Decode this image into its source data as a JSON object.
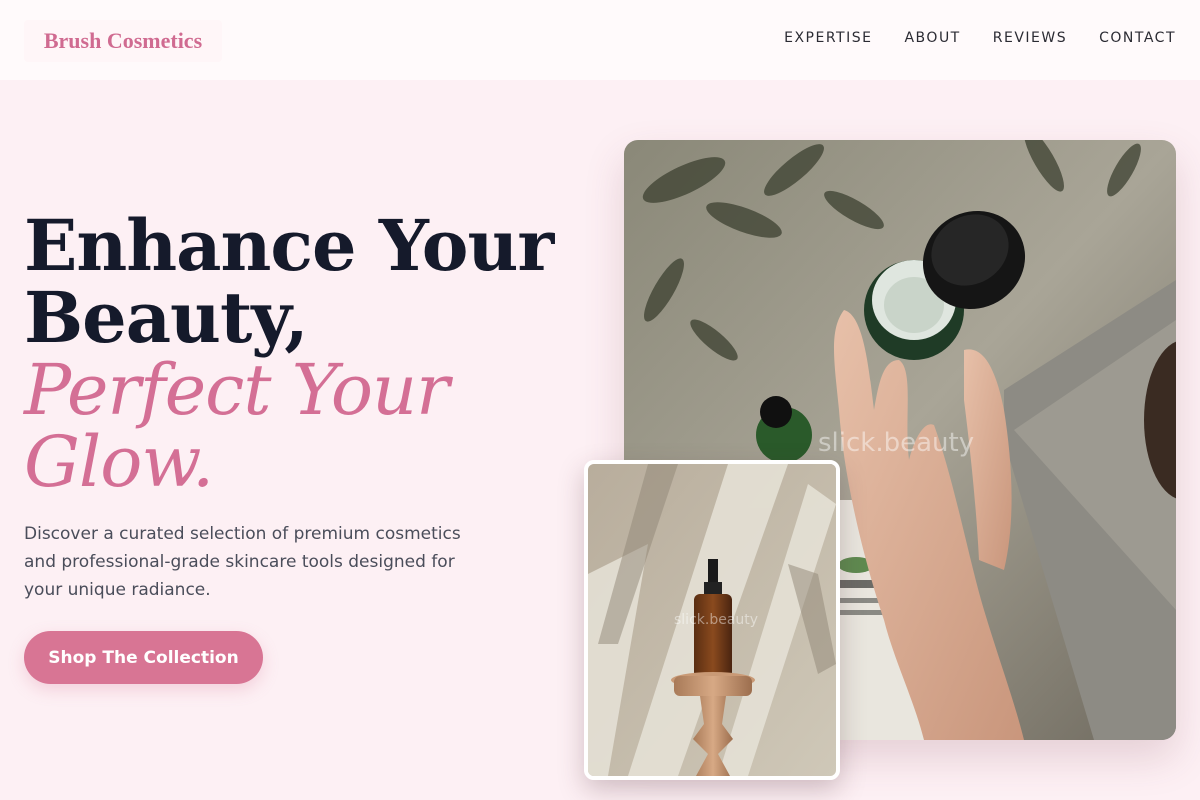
{
  "brand": {
    "name": "Brush Cosmetics"
  },
  "nav": [
    {
      "label": "EXPERTISE"
    },
    {
      "label": "ABOUT"
    },
    {
      "label": "REVIEWS"
    },
    {
      "label": "CONTACT"
    }
  ],
  "hero": {
    "title_line1": "Enhance Your",
    "title_line2": "Beauty,",
    "title_accent1": "Perfect Your",
    "title_accent2": "Glow.",
    "description": "Discover a curated selection of premium cosmetics and professional-grade skincare tools designed for your unique radiance.",
    "cta_label": "Shop The Collection"
  },
  "images": {
    "main_watermark": "slick.beauty",
    "small_watermark": "slick.beauty"
  },
  "colors": {
    "background": "#fdf0f4",
    "accent": "#d46f95",
    "heading": "#151a2b",
    "button": "#d87594"
  }
}
